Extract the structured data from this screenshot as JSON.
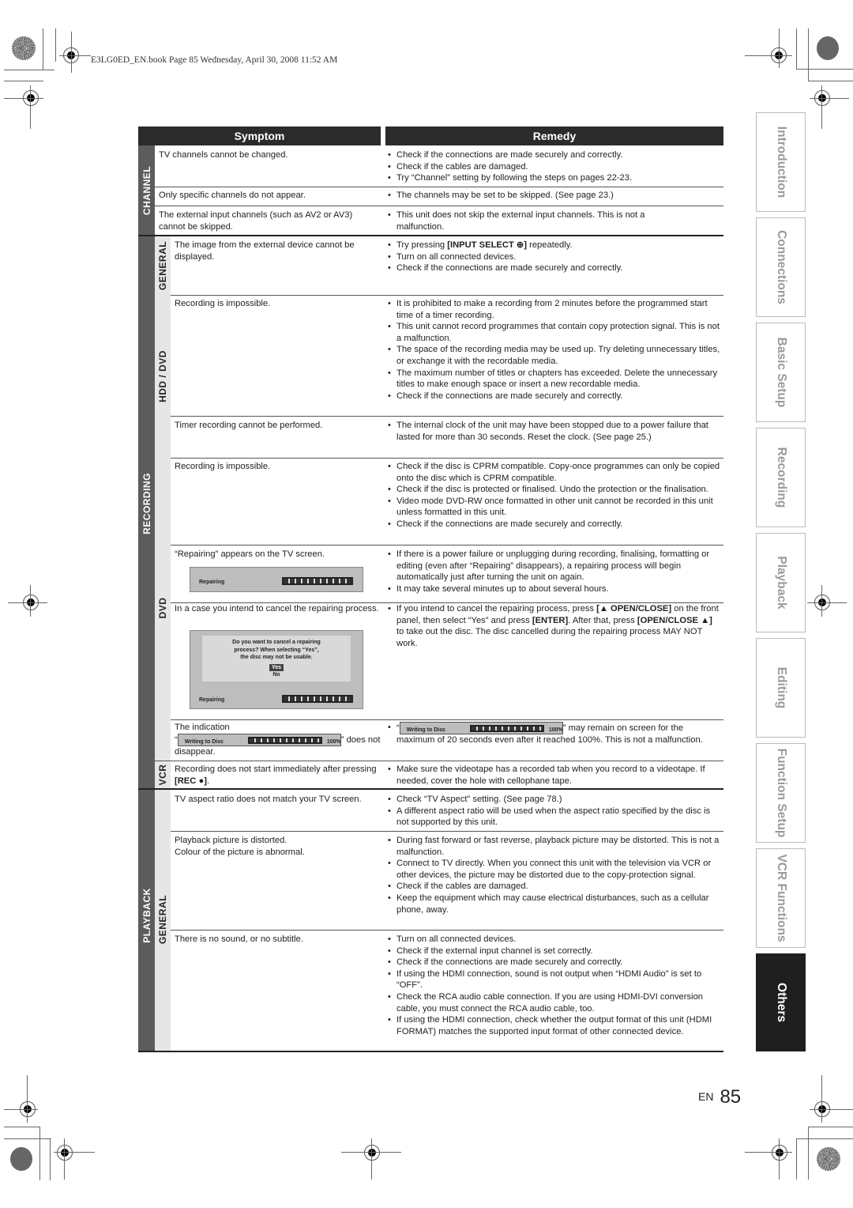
{
  "book_line": "E3LG0ED_EN.book  Page 85  Wednesday, April 30, 2008  11:52 AM",
  "table": {
    "header_symptom": "Symptom",
    "header_remedy": "Remedy",
    "categories": {
      "channel": "CHANNEL",
      "recording": "RECORDING",
      "playback": "PLAYBACK",
      "general": "GENERAL",
      "hdd_dvd": "HDD / DVD",
      "dvd": "DVD",
      "vcr": "VCR",
      "playback_general": "GENERAL"
    },
    "rows": [
      {
        "symptom": "TV channels cannot be changed.",
        "remedies": [
          "Check if the connections are made securely and correctly.",
          "Check if the cables are damaged.",
          "Try “Channel” setting by following the steps on pages 22-23."
        ]
      },
      {
        "symptom": "Only specific channels do not appear.",
        "remedies": [
          "The channels may be set to be skipped. (See page 23.)"
        ]
      },
      {
        "symptom": "The external input channels (such as AV2 or AV3) cannot be skipped.",
        "remedies": [
          "This unit does not skip the external input channels. This is not a malfunction."
        ]
      },
      {
        "symptom": "The image from the external device cannot be displayed.",
        "remedies": [
          "Try pressing [INPUT SELECT ⊕] repeatedly.",
          "Turn on all connected devices.",
          "Check if the connections are made securely and correctly."
        ],
        "remedy_0_pre": "Try pressing ",
        "remedy_0_bold": "[INPUT SELECT ⊕]",
        "remedy_0_post": " repeatedly."
      },
      {
        "symptom": "Recording is impossible.",
        "remedies": [
          "It is prohibited to make a recording from 2 minutes before the programmed start time of a timer recording.",
          "This unit cannot record programmes that contain copy protection signal. This is not a malfunction.",
          "The space of the recording media may be used up. Try deleting unnecessary titles, or exchange it with the recordable media.",
          "The maximum number of titles or chapters has exceeded. Delete the unnecessary titles to make enough space or insert a new recordable media.",
          "Check if the connections are made securely and correctly."
        ]
      },
      {
        "symptom": "Timer recording cannot be performed.",
        "remedies": [
          "The internal clock of the unit may have been stopped due to a power failure that lasted for more than 30 seconds. Reset the clock. (See page 25.)"
        ]
      },
      {
        "symptom": "Recording is impossible.",
        "remedies": [
          "Check if the disc is CPRM compatible.  Copy-once programmes can only be copied onto the disc which is CPRM compatible.",
          "Check if the disc is protected or finalised. Undo the protection or the finalisation.",
          "Video mode DVD-RW once formatted in other unit cannot be recorded in this unit unless formatted in this unit.",
          "Check if the connections are made securely and correctly."
        ]
      },
      {
        "symptom": "“Repairing” appears on the TV screen.",
        "remedies": [
          "If there is a power failure or unplugging during recording, finalising, formatting or editing (even after “Repairing” disappears), a repairing process will begin automatically just after turning the unit on again.",
          "It may take several minutes up to about several hours."
        ]
      },
      {
        "symptom": "In a case you intend to cancel the repairing process.",
        "remedy_parts": [
          "If you intend to cancel the repairing process, press ",
          "[▲ OPEN/CLOSE]",
          " on the front panel, then select “Yes” and press ",
          "[ENTER]",
          ". After that, press ",
          "[OPEN/CLOSE ▲]",
          " to take out the disc. The disc cancelled during the repairing process MAY NOT work."
        ]
      },
      {
        "symptom_pre": "The indication",
        "symptom_post": "” does not disappear.",
        "remedy_post": "” may remain on screen for the maximum of 20 seconds even after it reached 100%. This is not a malfunction."
      },
      {
        "symptom_pre": "Recording does not start immediately after pressing ",
        "symptom_bold": "[REC ●]",
        "symptom_post": ".",
        "remedies": [
          "Make sure the videotape has a recorded tab when you record to a videotape. If needed, cover the hole with cellophane tape."
        ]
      },
      {
        "symptom": "TV aspect ratio does not match your TV screen.",
        "remedies": [
          "Check “TV Aspect” setting. (See page 78.)",
          "A different aspect ratio will be used when the aspect ratio specified by the disc is not supported by this unit."
        ]
      },
      {
        "symptom_lines": [
          "Playback picture is distorted.",
          "Colour of the picture is abnormal."
        ],
        "remedies": [
          "During fast forward or fast reverse, playback picture may be distorted. This is not a malfunction.",
          "Connect to TV directly. When you connect this unit with the television via VCR or other devices, the picture may be distorted due to the copy-protection signal.",
          "Check if the cables are damaged.",
          "Keep the equipment which may cause electrical disturbances, such as a cellular phone, away."
        ]
      },
      {
        "symptom": "There is no sound, or no subtitle.",
        "remedies": [
          "Turn on all connected devices.",
          "Check if the external input channel is set correctly.",
          "Check if the connections are made securely and correctly.",
          "If using the HDMI connection, sound is not output when “HDMI Audio” is set to “OFF”.",
          "Check the RCA audio cable connection. If you are using HDMI-DVI conversion cable, you must connect the RCA audio cable, too.",
          "If using the HDMI connection, check whether the output format of this unit (HDMI FORMAT) matches the supported input format of other connected device."
        ]
      }
    ]
  },
  "osd": {
    "repairing_label": "Repairing",
    "dialog_lines": [
      "Do you want to cancel a repairing",
      "process? When selecting “Yes”,",
      "the disc may not be usable."
    ],
    "yes": "Yes",
    "no": "No",
    "writing_label": "Writing to Disc",
    "writing_percent": "100%",
    "writing_progress": 1.0
  },
  "side_tabs": [
    {
      "label": "Introduction",
      "active": false
    },
    {
      "label": "Connections",
      "active": false
    },
    {
      "label": "Basic Setup",
      "active": false
    },
    {
      "label": "Recording",
      "active": false
    },
    {
      "label": "Playback",
      "active": false
    },
    {
      "label": "Editing",
      "active": false
    },
    {
      "label": "Function Setup",
      "active": false
    },
    {
      "label": "VCR Functions",
      "active": false
    },
    {
      "label": "Others",
      "active": true
    }
  ],
  "footer": {
    "lang": "EN",
    "page": "85"
  }
}
